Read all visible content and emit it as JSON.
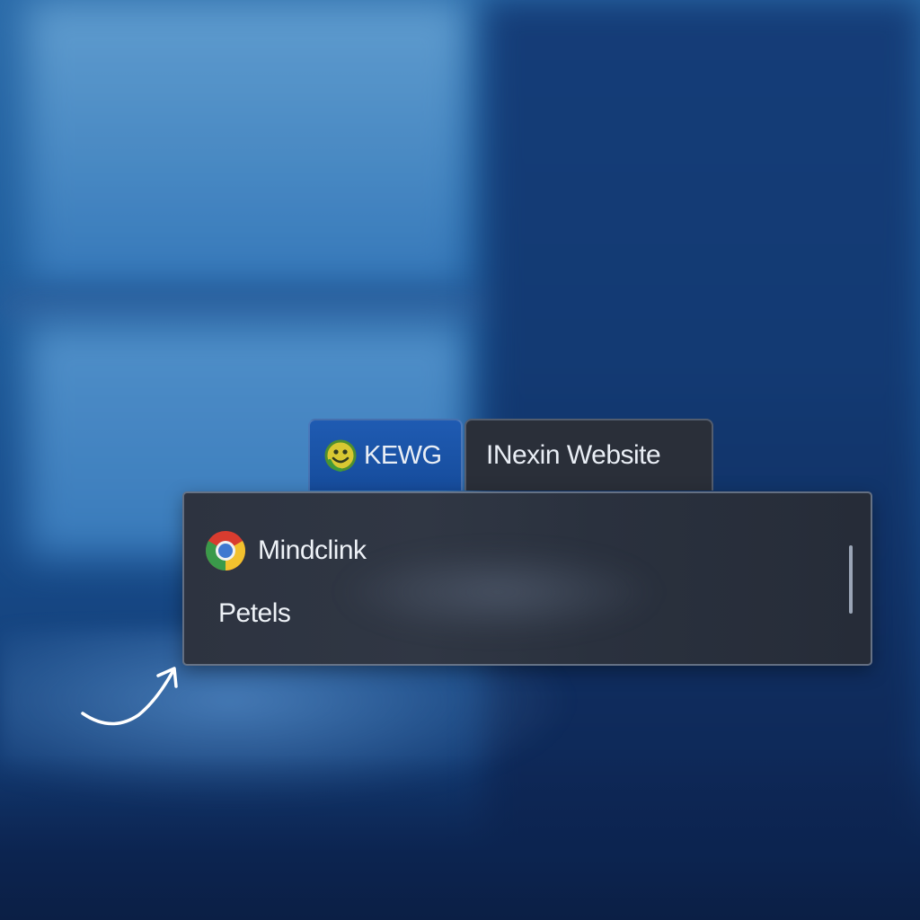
{
  "tabs": [
    {
      "label": "KEWG",
      "icon": "smiley-face-icon",
      "active": true
    },
    {
      "label": "INexin Website",
      "active": false
    }
  ],
  "dropdown": {
    "items": [
      {
        "label": "Mindclink",
        "icon": "chrome-icon"
      },
      {
        "label": "Petels"
      }
    ]
  },
  "colors": {
    "active_tab": "#1f5bb2",
    "inactive_tab": "#2a2f39",
    "panel": "#2d3340",
    "text": "#eef2f7"
  }
}
